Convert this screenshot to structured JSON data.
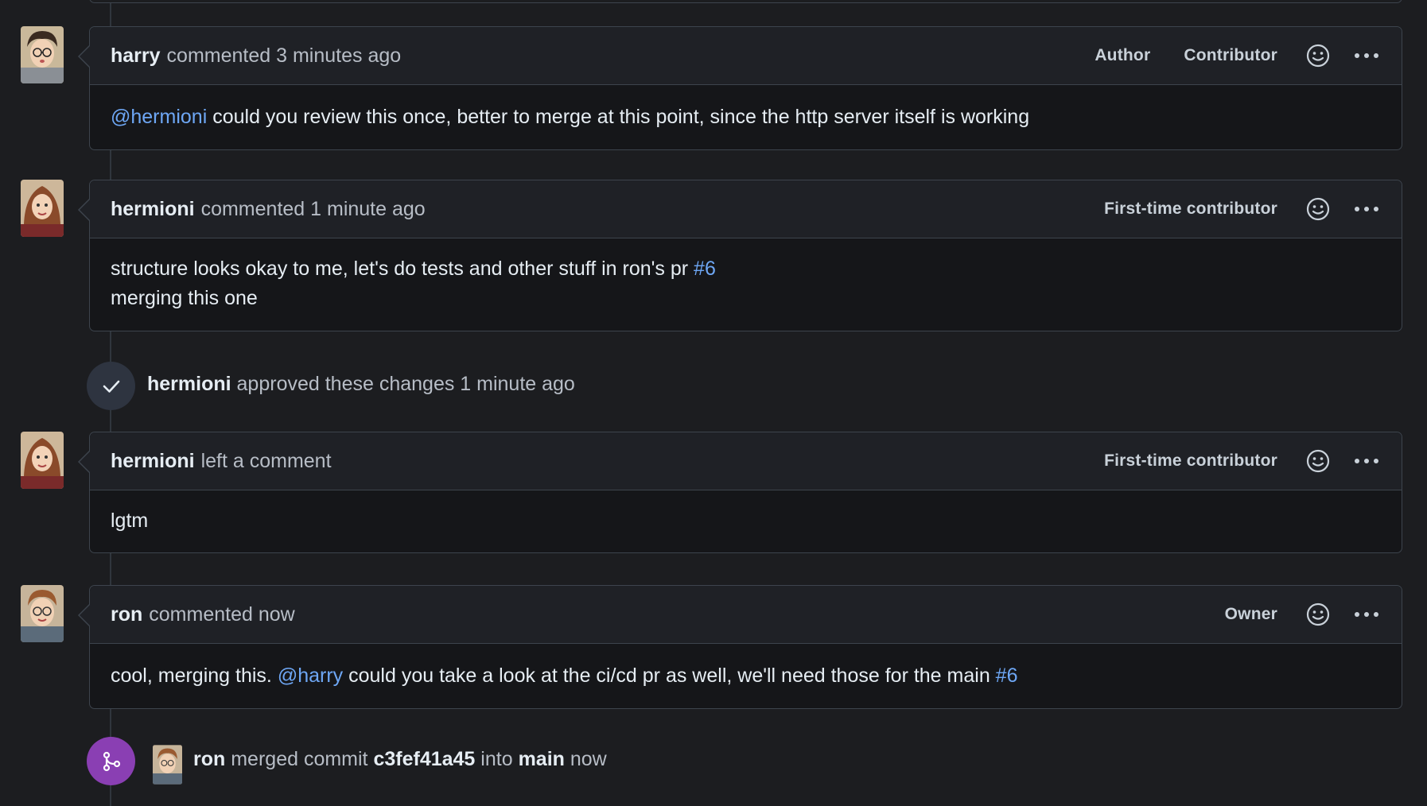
{
  "comments": [
    {
      "author": "harry",
      "action": "commented 3 minutes ago",
      "badges": [
        "Author",
        "Contributor"
      ],
      "body": [
        {
          "type": "mention",
          "text": "@hermioni"
        },
        {
          "type": "text",
          "text": " could you review this once, better to merge at this point, since the http server itself is working"
        }
      ]
    },
    {
      "author": "hermioni",
      "action": "commented 1 minute ago",
      "badges": [
        "First-time contributor"
      ],
      "body_line1": "structure looks okay to me, let's do tests and other stuff in ron's pr ",
      "body_ref": "#6",
      "body_line2": "merging this one"
    },
    {
      "author": "hermioni",
      "action": "left a comment",
      "badges": [
        "First-time contributor"
      ],
      "body": "lgtm"
    },
    {
      "author": "ron",
      "action": "commented now",
      "badges": [
        "Owner"
      ],
      "body_pre": "cool, merging this. ",
      "body_mention": "@harry",
      "body_mid": " could you take a look at the ci/cd pr as well, we'll need those for the main ",
      "body_ref": "#6"
    }
  ],
  "events": {
    "approved": {
      "actor": "hermioni",
      "text": "approved these changes 1 minute ago",
      "icon": "check-icon"
    },
    "merged": {
      "actor": "ron",
      "text1": "merged commit",
      "commit": "c3fef41a45",
      "text2": "into",
      "branch": "main",
      "text3": "now",
      "icon": "git-merge-icon",
      "color": "#8a3fb3"
    }
  },
  "colors": {
    "link": "#6ea7f5",
    "merge_purple": "#8a3fb3",
    "check_circle": "#2e3440"
  }
}
